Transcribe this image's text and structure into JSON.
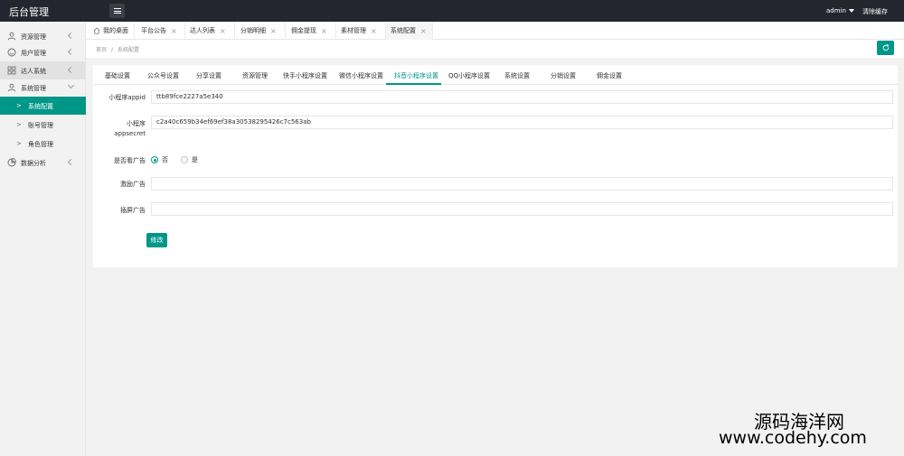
{
  "header": {
    "logo": "后台管理",
    "user": "admin",
    "clear_cache": "清除缓存"
  },
  "sidebar": {
    "items": [
      {
        "label": "资源管理",
        "icon": "user-icon"
      },
      {
        "label": "用户管理",
        "icon": "smile-icon"
      },
      {
        "label": "达人系统",
        "icon": "grid-icon"
      },
      {
        "label": "系统管理",
        "icon": "user-icon"
      },
      {
        "label": "数据分析",
        "icon": "chart-icon"
      }
    ],
    "sub_items": [
      {
        "label": "系统配置"
      },
      {
        "label": "账号管理"
      },
      {
        "label": "角色管理"
      }
    ]
  },
  "tabs": [
    {
      "label": "我的桌面"
    },
    {
      "label": "平台公告"
    },
    {
      "label": "达人列表"
    },
    {
      "label": "分销明细"
    },
    {
      "label": "佣金提现"
    },
    {
      "label": "素材管理"
    },
    {
      "label": "系统配置"
    }
  ],
  "breadcrumb": {
    "home": "首页",
    "separator": "/",
    "current": "系统配置"
  },
  "settings_tabs": [
    "基础设置",
    "公众号设置",
    "分享设置",
    "资源管理",
    "快手小程序设置",
    "微信小程序设置",
    "抖音小程序设置",
    "QQ小程序设置",
    "系统设置",
    "分销设置",
    "佣金设置"
  ],
  "form": {
    "appid_label": "小程序appid",
    "appid_value": "ttb89fce2227a5e340",
    "appsecret_label_1": "小程序",
    "appsecret_label_2": "appsecret",
    "appsecret_value": "c2a40c659b34ef69ef38a30538295426c7c563ab",
    "show_ad_label": "是否看广告",
    "option_no": "否",
    "option_yes": "是",
    "reward_ad_label": "激励广告",
    "interstitial_ad_label": "插屏广告",
    "submit_label": "修改"
  },
  "watermark": {
    "line1": "源码海洋网",
    "line2": "www.codehy.com"
  },
  "colors": {
    "accent": "#009688",
    "header_bg": "#23262e"
  }
}
